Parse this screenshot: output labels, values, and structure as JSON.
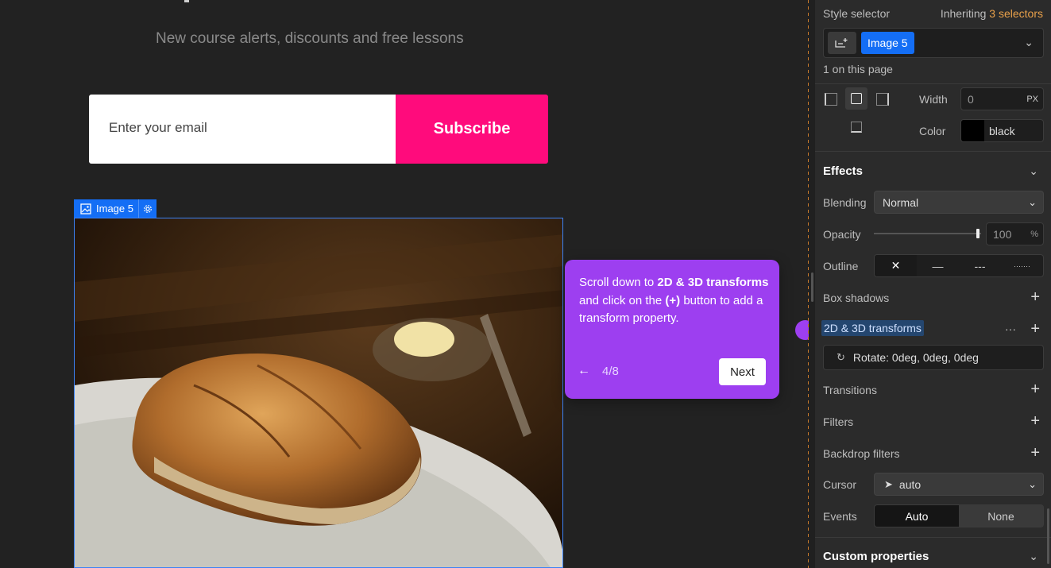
{
  "canvas": {
    "subtitle": "New course alerts, discounts and free lessons",
    "email_placeholder": "Enter your email",
    "subscribe_label": "Subscribe",
    "image_tag_label": "Image 5"
  },
  "tour": {
    "text_prefix": "Scroll down to ",
    "text_bold1": "2D & 3D transforms",
    "text_mid": " and click on the ",
    "text_bold2": "(+)",
    "text_suffix": " button to add a transform property.",
    "step": "4/8",
    "next_label": "Next",
    "back_icon": "←"
  },
  "panel": {
    "style_selector_label": "Style selector",
    "inheriting_prefix": "Inheriting",
    "inheriting_count": "3 selectors",
    "selector_chip": "Image 5",
    "on_page": "1 on this page",
    "width_label": "Width",
    "width_value": "0",
    "width_unit": "PX",
    "color_label": "Color",
    "color_value": "black",
    "effects_title": "Effects",
    "blending_label": "Blending",
    "blending_value": "Normal",
    "opacity_label": "Opacity",
    "opacity_value": "100",
    "opacity_unit": "%",
    "opacity_level": 1.0,
    "outline_label": "Outline",
    "outline_options": [
      "✕",
      "—",
      "---",
      "·······"
    ],
    "box_shadows_label": "Box shadows",
    "transforms_label": "2D & 3D transforms",
    "transforms_more": "···",
    "rotate_value": "Rotate: 0deg, 0deg, 0deg",
    "transitions_label": "Transitions",
    "filters_label": "Filters",
    "backdrop_label": "Backdrop filters",
    "cursor_label": "Cursor",
    "cursor_value": "auto",
    "events_label": "Events",
    "events_auto": "Auto",
    "events_none": "None",
    "custom_props_title": "Custom properties",
    "accent_color": "#146ef5",
    "brand_pink": "#ff0b7c",
    "tour_purple": "#9d3ff0"
  }
}
